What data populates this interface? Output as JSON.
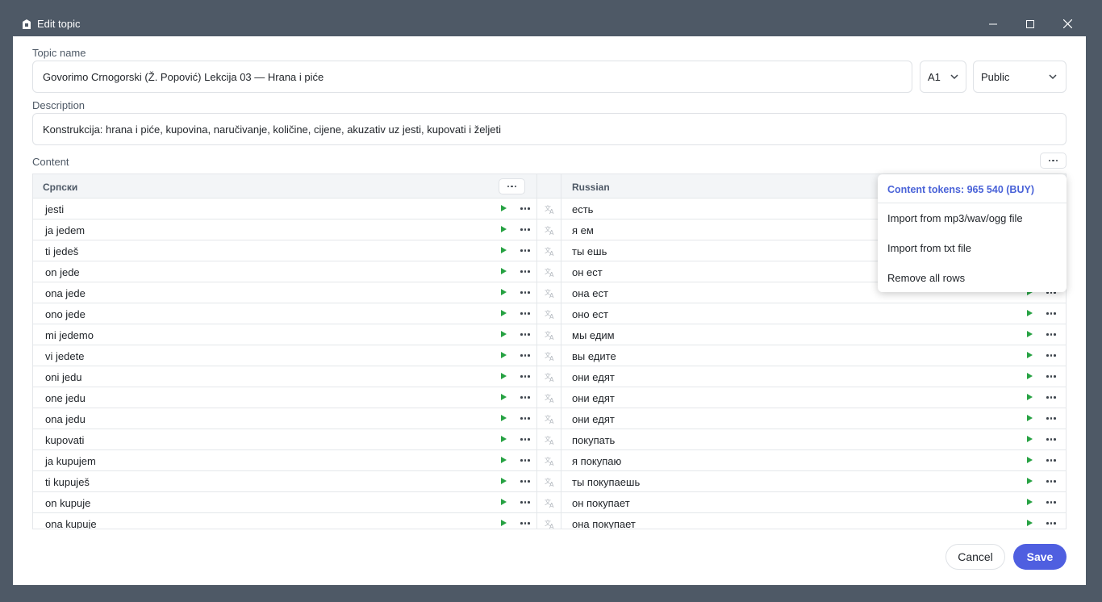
{
  "window": {
    "title": "Edit topic"
  },
  "topic": {
    "name_label": "Topic name",
    "name_value": "Govorimo Crnogorski (Ž. Popović) Lekcija 03 — Hrana i piće",
    "level": "A1",
    "visibility": "Public"
  },
  "description": {
    "label": "Description",
    "value": "Konstrukcija: hrana i piće, kupovina, naručivanje, količine, cijene, akuzativ uz jesti, kupovati i željeti"
  },
  "content": {
    "label": "Content",
    "col1_header": "Српски",
    "col2_header": "Russian",
    "rows": [
      {
        "sr": "jesti",
        "ru": "есть"
      },
      {
        "sr": "ja jedem",
        "ru": "я ем"
      },
      {
        "sr": "ti jedeš",
        "ru": "ты ешь"
      },
      {
        "sr": "on jede",
        "ru": "он ест"
      },
      {
        "sr": "ona jede",
        "ru": "она ест"
      },
      {
        "sr": "ono jede",
        "ru": "оно ест"
      },
      {
        "sr": "mi jedemo",
        "ru": "мы едим"
      },
      {
        "sr": "vi jedete",
        "ru": "вы едите"
      },
      {
        "sr": "oni jedu",
        "ru": "они едят"
      },
      {
        "sr": "one jedu",
        "ru": "они едят"
      },
      {
        "sr": "ona jedu",
        "ru": "они едят"
      },
      {
        "sr": "kupovati",
        "ru": "покупать"
      },
      {
        "sr": "ja kupujem",
        "ru": "я покупаю"
      },
      {
        "sr": "ti kupuješ",
        "ru": "ты покупаешь"
      },
      {
        "sr": "on kupuje",
        "ru": "он покупает"
      },
      {
        "sr": "ona kupuje",
        "ru": "она покупает"
      }
    ]
  },
  "menu": {
    "tokens": "Content tokens: 965 540 (BUY)",
    "import_audio": "Import from mp3/wav/ogg file",
    "import_txt": "Import from txt file",
    "remove_all": "Remove all rows"
  },
  "footer": {
    "cancel": "Cancel",
    "save": "Save"
  },
  "colors": {
    "accent": "#4f5fe0",
    "play": "#27a243",
    "titlebar": "#4e5966"
  }
}
